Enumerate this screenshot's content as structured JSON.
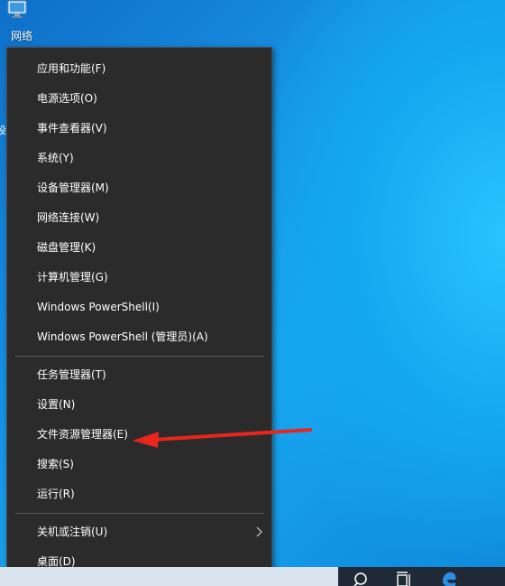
{
  "desktop": {
    "network_icon_label": "网络",
    "partial_text": "设"
  },
  "menu": {
    "group1": [
      "应用和功能(F)",
      "电源选项(O)",
      "事件查看器(V)",
      "系统(Y)",
      "设备管理器(M)",
      "网络连接(W)",
      "磁盘管理(K)",
      "计算机管理(G)",
      "Windows PowerShell(I)",
      "Windows PowerShell (管理员)(A)"
    ],
    "group2": [
      "任务管理器(T)",
      "设置(N)",
      "文件资源管理器(E)",
      "搜索(S)",
      "运行(R)"
    ],
    "group3": [
      "关机或注销(U)",
      "桌面(D)"
    ]
  },
  "colors": {
    "menu_bg": "#2b2b2b",
    "menu_text": "#ffffff",
    "arrow": "#e8261e",
    "desktop_blue": "#1aa3ee"
  },
  "icons": {
    "desktop": "network-computer-icon",
    "submenu": "chevron-right-icon",
    "taskbar": [
      "search-icon",
      "task-view-icon",
      "edge-icon"
    ]
  }
}
